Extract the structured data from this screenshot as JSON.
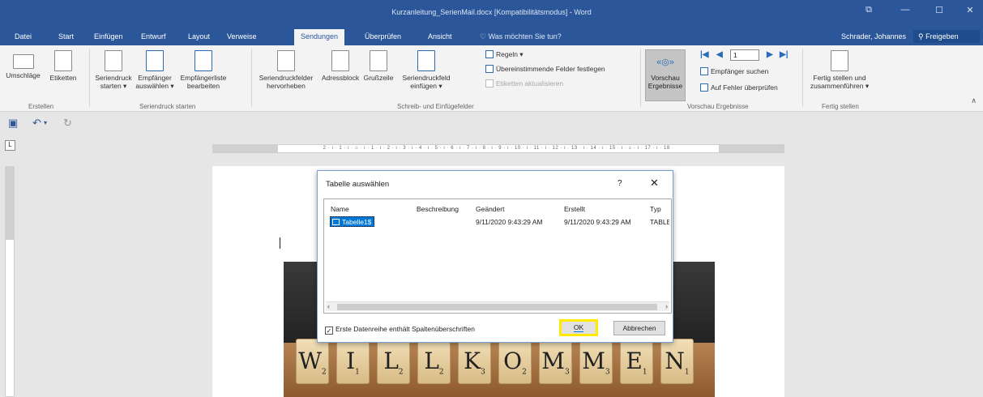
{
  "window": {
    "title": "Kurzanleitung_SerienMail.docx [Kompatibilitätsmodus] - Word",
    "controls": [
      "⧉",
      "—",
      "☐",
      "✕"
    ]
  },
  "menu": {
    "tabs": [
      "Datei",
      "Start",
      "Einfügen",
      "Entwurf",
      "Layout",
      "Verweise",
      "Sendungen",
      "Überprüfen",
      "Ansicht"
    ],
    "active_tab": "Sendungen",
    "tell_me": "Was möchten Sie tun?",
    "user": "Schrader, Johannes",
    "share": "Freigeben"
  },
  "ribbon": {
    "umschlaege": "Umschläge",
    "etiketten": "Etiketten",
    "group_erstellen": "Erstellen",
    "seriendruck_starten_l1": "Seriendruck",
    "seriendruck_starten_l2": "starten ▾",
    "empfaenger_l1": "Empfänger",
    "empfaenger_l2": "auswählen ▾",
    "empfaengerliste_l1": "Empfängerliste",
    "empfaengerliste_l2": "bearbeiten",
    "group_seriendruck": "Seriendruck starten",
    "seriendruckfelder_l1": "Seriendruckfelder",
    "seriendruckfelder_l2": "hervorheben",
    "adressblock": "Adressblock",
    "grusszeile": "Grußzeile",
    "seriendruckfeld_l1": "Seriendruckfeld",
    "seriendruckfeld_l2": "einfügen ▾",
    "regeln": "Regeln ▾",
    "uebereinstimmende": "Übereinstimmende Felder festlegen",
    "etiketten_aktualisieren": "Etiketten aktualisieren",
    "group_schreib": "Schreib- und Einfügefelder",
    "vorschau_l1": "Vorschau",
    "vorschau_l2": "Ergebnisse",
    "record_value": "1",
    "empfaenger_suchen": "Empfänger suchen",
    "auf_fehler": "Auf Fehler überprüfen",
    "group_vorschau": "Vorschau Ergebnisse",
    "fertig_l1": "Fertig stellen und",
    "fertig_l2": "zusammenführen ▾",
    "group_fertig": "Fertig stellen"
  },
  "ruler": {
    "ticks": "2 · ı · 1 · ı · ⌂ · ı · 1 · ı · 2 · ı · 3 · ı · 4 · ı · 5 · ı · 6 · ı · 7 · ı · 8 · ı · 9 · ı · 10 · ı · 11 · ı · 12 · ı · 13 · ı · 14 · ı · 15 · ı · ⌂ · ı · 17 · ı · 18 ·",
    "corner": "L"
  },
  "dialog": {
    "title": "Tabelle auswählen",
    "help": "?",
    "close": "✕",
    "columns": [
      "Name",
      "Beschreibung",
      "Geändert",
      "Erstellt",
      "Typ"
    ],
    "rows": [
      {
        "name": "Tabelle1$",
        "beschreibung": "",
        "geaendert": "9/11/2020 9:43:29 AM",
        "erstellt": "9/11/2020 9:43:29 AM",
        "typ": "TABLE"
      }
    ],
    "checkbox_label": "Erste Datenreihe enthält Spaltenüberschriften",
    "checkbox_checked": true,
    "ok": "OK",
    "cancel": "Abbrechen"
  },
  "photo": {
    "tiles": [
      {
        "letter": "W",
        "score": "2"
      },
      {
        "letter": "I",
        "score": "1"
      },
      {
        "letter": "L",
        "score": "2"
      },
      {
        "letter": "L",
        "score": "2"
      },
      {
        "letter": "K",
        "score": "3"
      },
      {
        "letter": "O",
        "score": "2"
      },
      {
        "letter": "M",
        "score": "3"
      },
      {
        "letter": "M",
        "score": "3"
      },
      {
        "letter": "E",
        "score": "1"
      },
      {
        "letter": "N",
        "score": "1"
      }
    ]
  }
}
